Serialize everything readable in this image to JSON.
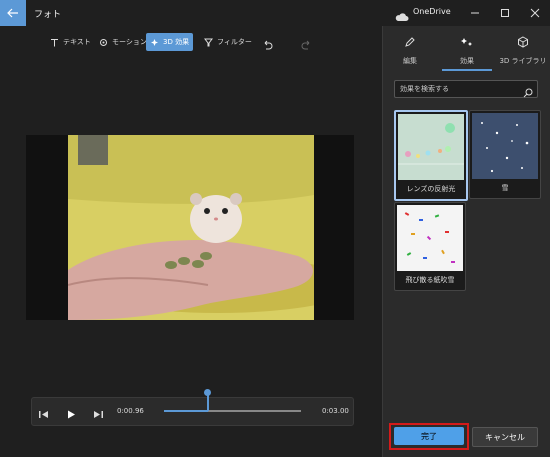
{
  "titlebar": {
    "app_title": "フォト",
    "cloud_label": "OneDrive"
  },
  "toolbar": {
    "text_label": "テキスト",
    "motion_label": "モーション",
    "effects3d_label": "3D 効果",
    "filter_label": "フィルター"
  },
  "playback": {
    "current_time": "0:00.96",
    "total_time": "0:03.00",
    "progress": 0.32
  },
  "panel": {
    "tabs": [
      {
        "label": "編集",
        "icon": "pencil-icon"
      },
      {
        "label": "効果",
        "icon": "sparkle-icon"
      },
      {
        "label": "3D ライブラリ",
        "icon": "cube-icon"
      }
    ],
    "search_placeholder": "効果を検索する",
    "effects": [
      {
        "label": "レンズの反射光",
        "selected": true
      },
      {
        "label": "雪",
        "selected": false
      },
      {
        "label": "飛び散る紙吹雪",
        "selected": false
      }
    ]
  },
  "footer": {
    "done_label": "完了",
    "cancel_label": "キャンセル"
  },
  "colors": {
    "accent": "#5c99d6",
    "done": "#4fa0e8",
    "highlight": "#d41a1a"
  }
}
